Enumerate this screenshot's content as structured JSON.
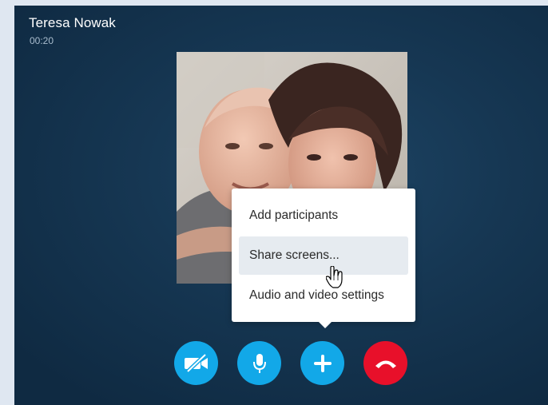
{
  "call": {
    "caller_name": "Teresa Nowak",
    "duration": "00:20"
  },
  "popup_menu": {
    "items": [
      {
        "label": "Add participants",
        "highlighted": false
      },
      {
        "label": "Share screens...",
        "highlighted": true
      },
      {
        "label": "Audio and video settings",
        "highlighted": false
      }
    ]
  },
  "controls": {
    "buttons": [
      {
        "icon": "video-off-icon",
        "color": "#12a8e8"
      },
      {
        "icon": "microphone-icon",
        "color": "#12a8e8"
      },
      {
        "icon": "plus-icon",
        "color": "#12a8e8"
      },
      {
        "icon": "hang-up-icon",
        "color": "#e8102a"
      }
    ]
  },
  "colors": {
    "accent": "#12a8e8",
    "hangup": "#e8102a",
    "window_bg": "#163753",
    "page_bg": "#dfe7f1"
  }
}
